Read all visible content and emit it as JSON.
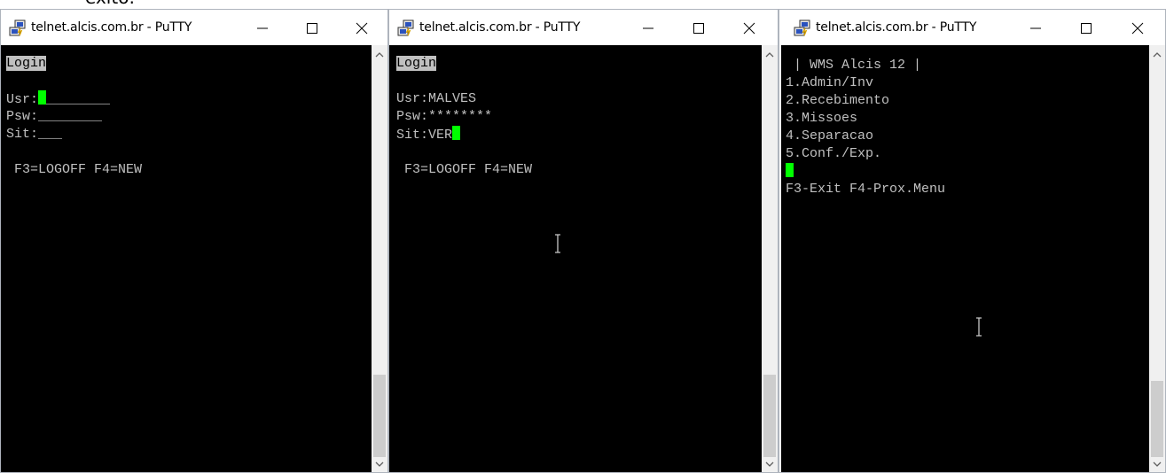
{
  "top_fragment": "exito:",
  "windows": [
    {
      "title": "telnet.alcis.com.br - PuTTY",
      "lines": [
        "Login",
        "",
        "Usr:",
        "Psw:________",
        "Sit:___",
        "",
        " F3=LOGOFF F4=NEW"
      ],
      "usr_trail": "________"
    },
    {
      "title": "telnet.alcis.com.br - PuTTY",
      "lines": [
        "Login",
        "",
        "Usr:MALVES",
        "Psw:********",
        "Sit:VER",
        "",
        " F3=LOGOFF F4=NEW"
      ]
    },
    {
      "title": "telnet.alcis.com.br - PuTTY",
      "lines": [
        " | WMS Alcis 12 |",
        "1.Admin/Inv",
        "2.Recebimento",
        "3.Missoes",
        "4.Separacao",
        "5.Conf./Exp.",
        "",
        "F3-Exit F4-Prox.Menu"
      ]
    }
  ],
  "colors": {
    "terminal_bg": "#000000",
    "terminal_fg": "#c0c0c0",
    "cursor": "#00ff00",
    "highlight": "#c0c0c0"
  }
}
